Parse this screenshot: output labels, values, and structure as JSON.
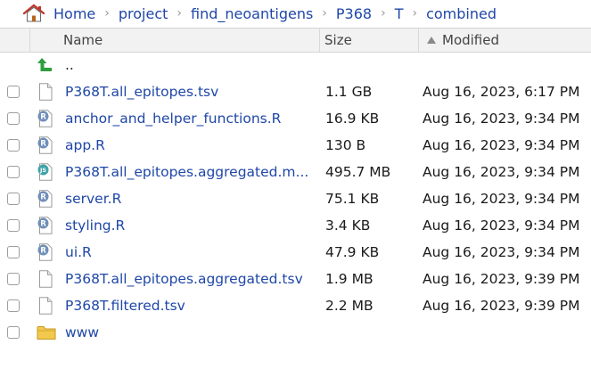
{
  "breadcrumb": [
    "Home",
    "project",
    "find_neoantigens",
    "P368",
    "T",
    "combined"
  ],
  "columns": {
    "name": "Name",
    "size": "Size",
    "modified": "Modified"
  },
  "rows": [
    {
      "type": "up",
      "name": "..",
      "size": "",
      "modified": "",
      "icon": "up-arrow-icon"
    },
    {
      "type": "file",
      "name": "P368T.all_epitopes.tsv",
      "size": "1.1 GB",
      "modified": "Aug 16, 2023, 6:17 PM",
      "icon": "text-file-icon"
    },
    {
      "type": "file",
      "name": "anchor_and_helper_functions.R",
      "size": "16.9 KB",
      "modified": "Aug 16, 2023, 9:34 PM",
      "icon": "r-file-icon"
    },
    {
      "type": "file",
      "name": "app.R",
      "size": "130 B",
      "modified": "Aug 16, 2023, 9:34 PM",
      "icon": "r-file-icon"
    },
    {
      "type": "file",
      "name": "P368T.all_epitopes.aggregated.m...",
      "size": "495.7 MB",
      "modified": "Aug 16, 2023, 9:34 PM",
      "icon": "js-file-icon"
    },
    {
      "type": "file",
      "name": "server.R",
      "size": "75.1 KB",
      "modified": "Aug 16, 2023, 9:34 PM",
      "icon": "r-file-icon"
    },
    {
      "type": "file",
      "name": "styling.R",
      "size": "3.4 KB",
      "modified": "Aug 16, 2023, 9:34 PM",
      "icon": "r-file-icon"
    },
    {
      "type": "file",
      "name": "ui.R",
      "size": "47.9 KB",
      "modified": "Aug 16, 2023, 9:34 PM",
      "icon": "r-file-icon"
    },
    {
      "type": "file",
      "name": "P368T.all_epitopes.aggregated.tsv",
      "size": "1.9 MB",
      "modified": "Aug 16, 2023, 9:39 PM",
      "icon": "text-file-icon"
    },
    {
      "type": "file",
      "name": "P368T.filtered.tsv",
      "size": "2.2 MB",
      "modified": "Aug 16, 2023, 9:39 PM",
      "icon": "text-file-icon"
    },
    {
      "type": "folder",
      "name": "www",
      "size": "",
      "modified": "",
      "icon": "folder-icon"
    }
  ],
  "colors": {
    "link": "#1f47a8",
    "header_bg": "#f2f2f2",
    "home_red": "#c0392b",
    "up_green": "#2e9e3e",
    "folder_yellow": "#f2c94c"
  }
}
